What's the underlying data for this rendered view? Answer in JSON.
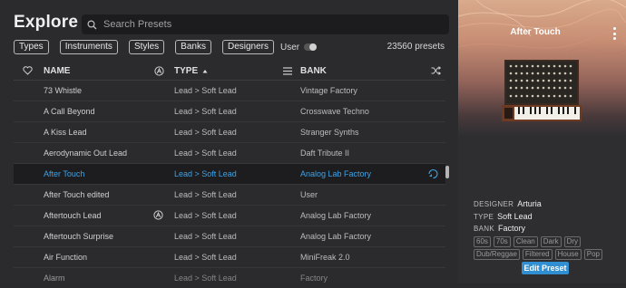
{
  "explore": {
    "title": "Explore",
    "search_placeholder": "Search Presets",
    "filters": [
      "Types",
      "Instruments",
      "Styles",
      "Banks",
      "Designers"
    ],
    "user_label": "User",
    "preset_count": "23560 presets"
  },
  "columns": {
    "name": "NAME",
    "type": "TYPE",
    "bank": "BANK"
  },
  "rows": [
    {
      "name": "73 Whistle",
      "type": "Lead > Soft Lead",
      "bank": "Vintage Factory"
    },
    {
      "name": "A Call Beyond",
      "type": "Lead > Soft Lead",
      "bank": "Crosswave Techno"
    },
    {
      "name": "A Kiss Lead",
      "type": "Lead > Soft Lead",
      "bank": "Stranger Synths"
    },
    {
      "name": "Aerodynamic Out Lead",
      "type": "Lead > Soft Lead",
      "bank": "Daft Tribute II"
    },
    {
      "name": "After Touch",
      "type": "Lead > Soft Lead",
      "bank": "Analog Lab Factory"
    },
    {
      "name": "After Touch edited",
      "type": "Lead > Soft Lead",
      "bank": "User"
    },
    {
      "name": "Aftertouch Lead",
      "type": "Lead > Soft Lead",
      "bank": "Analog Lab Factory"
    },
    {
      "name": "Aftertouch Surprise",
      "type": "Lead > Soft Lead",
      "bank": "Analog Lab Factory"
    },
    {
      "name": "Air Function",
      "type": "Lead > Soft Lead",
      "bank": "MiniFreak 2.0"
    },
    {
      "name": "Alarm",
      "type": "Lead > Soft Lead",
      "bank": "Factory"
    }
  ],
  "selected_preset": {
    "title": "After Touch",
    "designer_label": "DESIGNER",
    "designer": "Arturia",
    "type_label": "TYPE",
    "type": "Soft Lead",
    "bank_label": "BANK",
    "bank": "Factory",
    "tags": [
      "60s",
      "70s",
      "Clean",
      "Dark",
      "Dry",
      "Dub/Reggae",
      "Filtered",
      "House",
      "Pop"
    ],
    "edit_button": "Edit Preset"
  },
  "colors": {
    "accent": "#3fa3e6",
    "button": "#2f8fd0",
    "background": "#2b2b2e"
  }
}
